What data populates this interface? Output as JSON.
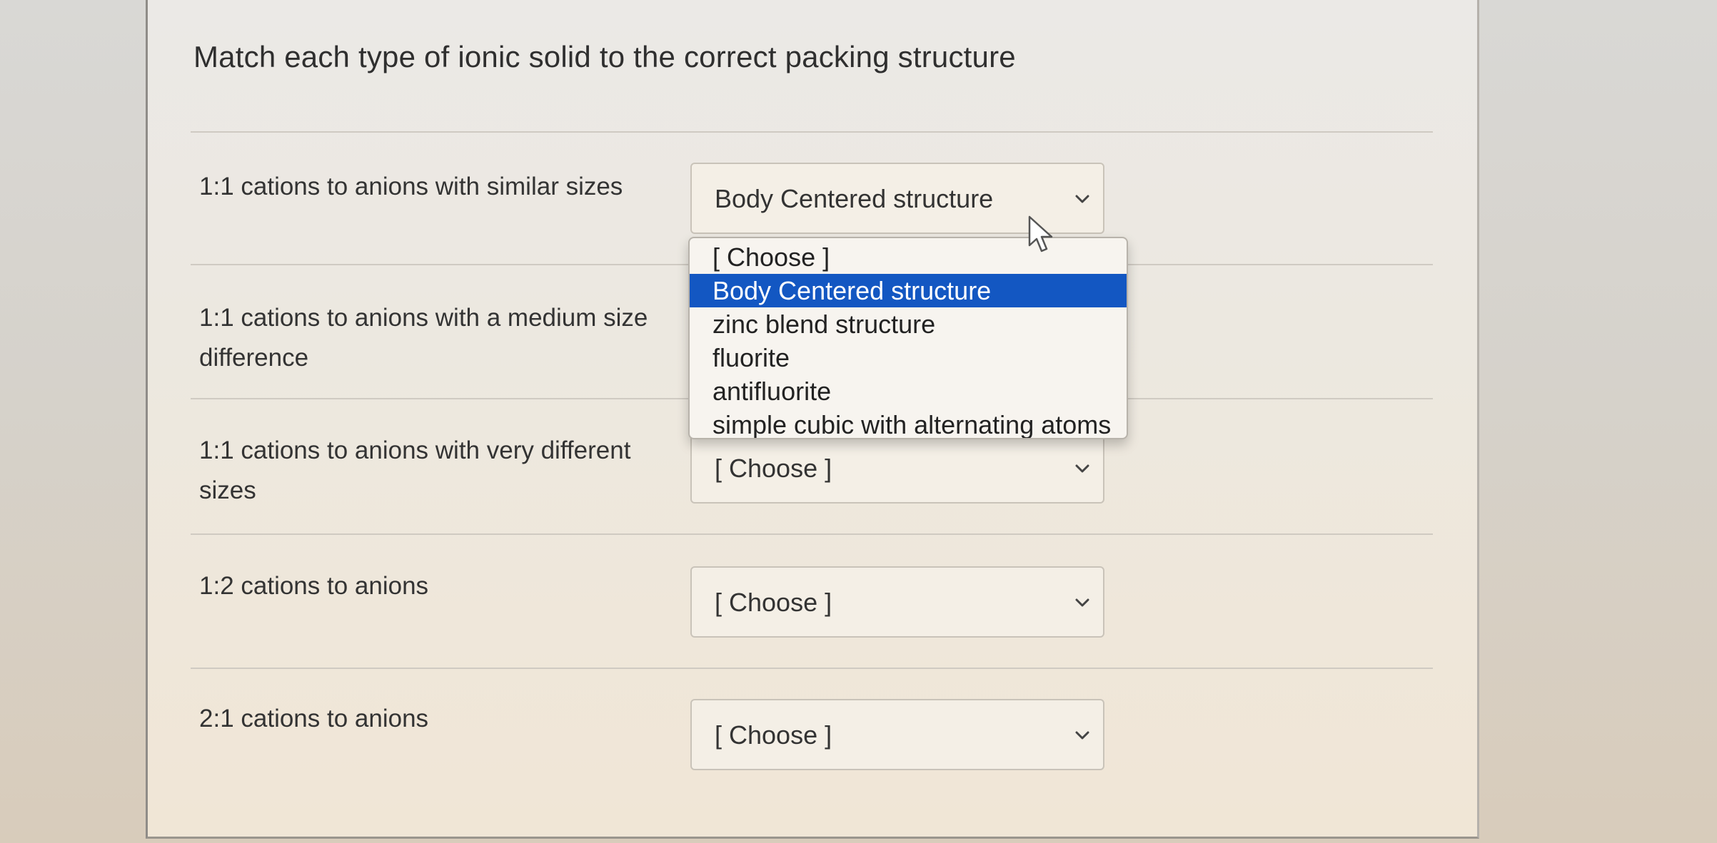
{
  "question": {
    "text": "Match each type of ionic solid to the correct packing structure"
  },
  "rows": [
    {
      "label": "1:1 cations to anions with similar sizes",
      "selected": "Body Centered structure"
    },
    {
      "label": "1:1 cations to anions with a medium size difference",
      "selected": ""
    },
    {
      "label": "1:1 cations to anions with very different sizes",
      "selected": "[ Choose ]"
    },
    {
      "label": "1:2 cations to anions",
      "selected": "[ Choose ]"
    },
    {
      "label": "2:1 cations to anions",
      "selected": "[ Choose ]"
    }
  ],
  "dropdown": {
    "options": [
      "[ Choose ]",
      "Body Centered structure",
      "zinc blend structure",
      "fluorite",
      "antifluorite",
      "simple cubic with alternating atoms"
    ],
    "highlighted": "Body Centered structure"
  },
  "icons": {
    "chevron": "chevron-down-icon",
    "cursor": "mouse-pointer-icon"
  },
  "colors": {
    "highlight": "#1357c2",
    "text": "#333333"
  }
}
